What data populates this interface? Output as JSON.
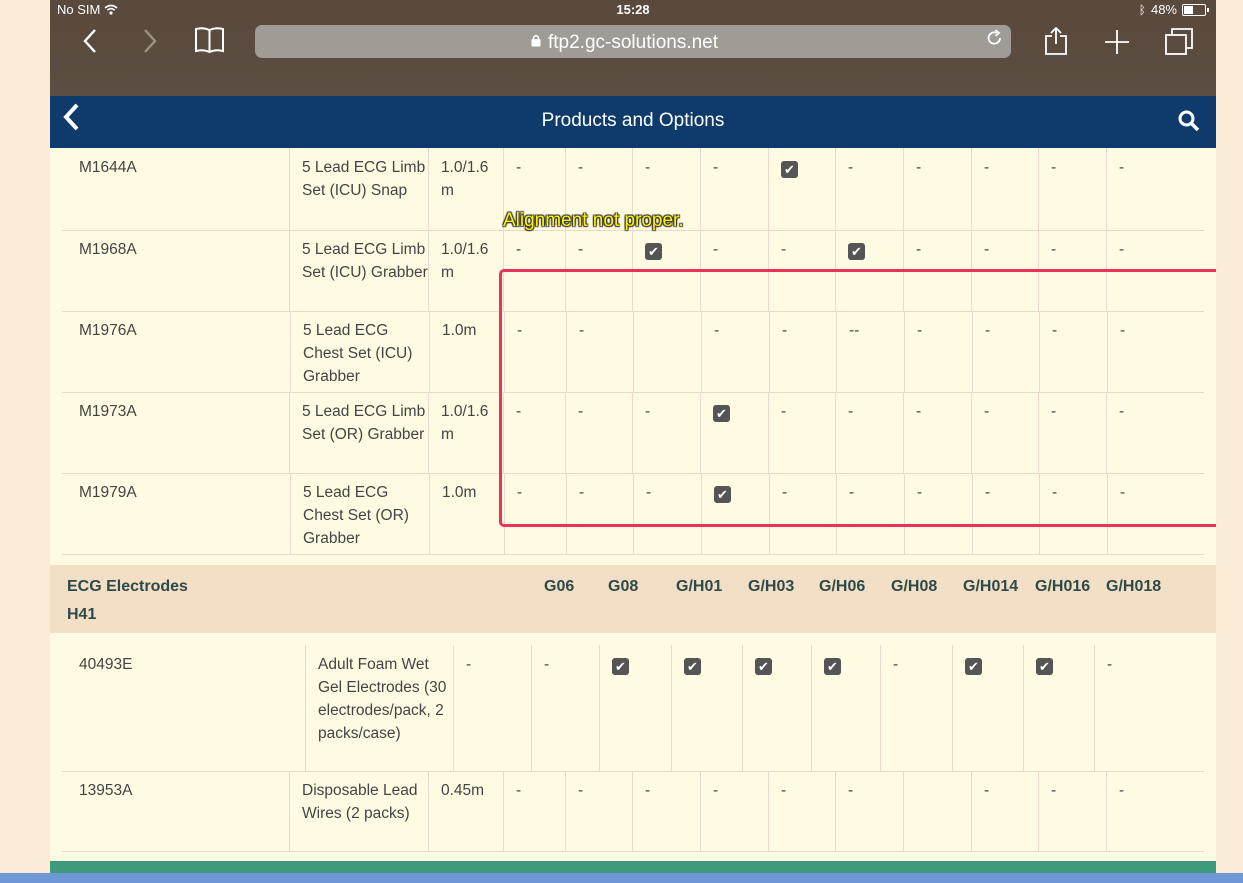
{
  "status": {
    "carrier": "No SIM",
    "time": "15:28",
    "battery": "48%",
    "battery_level": 0.48
  },
  "browser": {
    "url": "ftp2.gc-solutions.net"
  },
  "header": {
    "title": "Products and Options"
  },
  "table1": {
    "rows": [
      {
        "code": "M1644A",
        "desc": "5 Lead ECG Limb Set (ICU) Snap",
        "length": "1.0/1.6 m",
        "cells": [
          "-",
          "-",
          "-",
          "-",
          "check",
          "-",
          "-",
          "-",
          "-",
          "-"
        ]
      },
      {
        "code": "M1968A",
        "desc": "5 Lead ECG Limb Set (ICU) Grabber",
        "length": "1.0/1.6 m",
        "cells": [
          "-",
          "-",
          "check",
          "-",
          "-",
          "check",
          "-",
          "-",
          "-",
          "-"
        ]
      },
      {
        "code": "M1976A",
        "desc": "5 Lead ECG Chest Set (ICU) Grabber",
        "length": "1.0m",
        "cells": [
          "-",
          "-",
          "",
          "-",
          "-",
          "--",
          "-",
          "-",
          "-",
          "-"
        ]
      },
      {
        "code": "M1973A",
        "desc": "5 Lead ECG Limb Set (OR) Grabber",
        "length": "1.0/1.6 m",
        "cells": [
          "-",
          "-",
          "-",
          "check",
          "-",
          "-",
          "-",
          "-",
          "-",
          "-"
        ]
      },
      {
        "code": "M1979A",
        "desc": "5 Lead ECG Chest Set (OR) Grabber",
        "length": "1.0m",
        "cells": [
          "-",
          "-",
          "-",
          "check",
          "-",
          "-",
          "-",
          "-",
          "-",
          "-"
        ]
      }
    ]
  },
  "section": {
    "title_line1": "ECG Electrodes",
    "title_line2": "H41",
    "columns": [
      "G06",
      "G08",
      "G/H01",
      "G/H03",
      "G/H06",
      "G/H08",
      "G/H014",
      "G/H016",
      "G/H018"
    ]
  },
  "table2": {
    "rows": [
      {
        "code": "40493E",
        "desc": "Adult Foam Wet Gel Electrodes (30 electrodes/pack, 2 packs/case)",
        "length": "-",
        "cells": [
          "-",
          "check",
          "check",
          "check",
          "check",
          "-",
          "check",
          "check",
          "-"
        ]
      },
      {
        "code": "13953A",
        "desc": "Disposable Lead Wires (2 packs)",
        "length": "0.45m",
        "cells": [
          "-",
          "-",
          "-",
          "-",
          "-",
          "-",
          "",
          "-",
          "-",
          "-"
        ]
      }
    ]
  },
  "annotation": {
    "text": "Alignment not proper."
  }
}
